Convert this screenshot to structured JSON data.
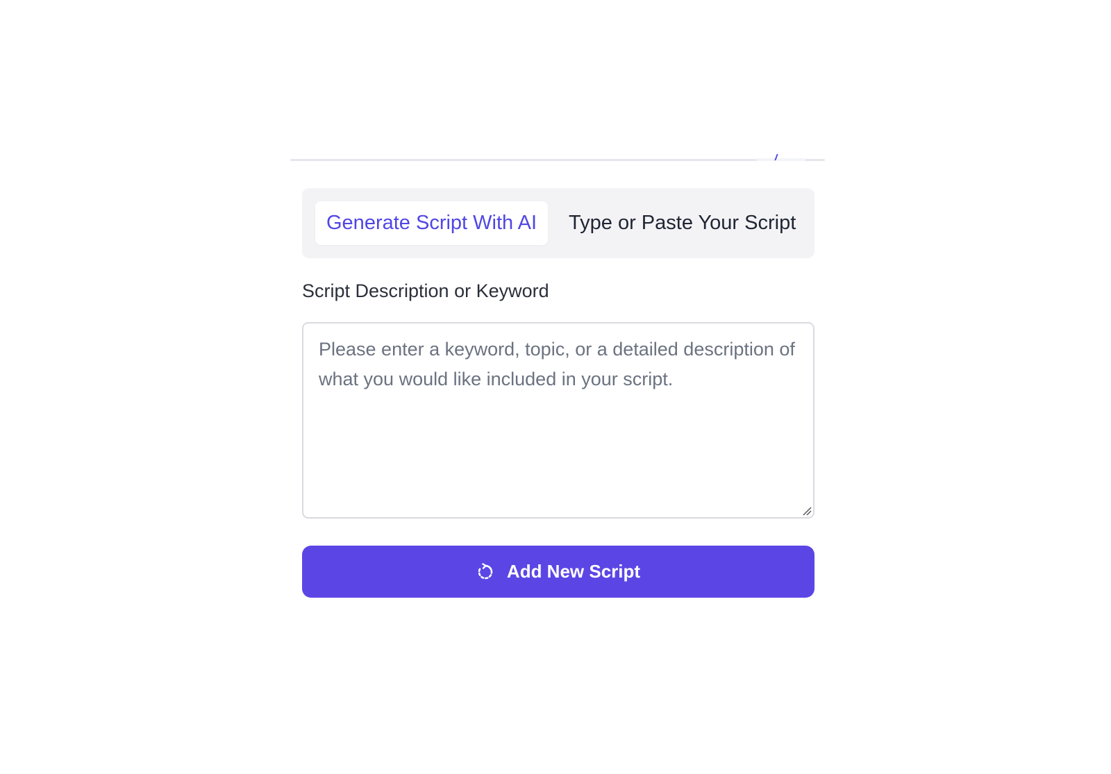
{
  "tabs": {
    "generate_ai": "Generate Script With AI",
    "type_paste": "Type or Paste Your Script",
    "active": "generate_ai"
  },
  "form": {
    "label": "Script Description or Keyword",
    "value": "",
    "placeholder": "Please enter a keyword, topic, or a detailed description of what you would like included in your script."
  },
  "action": {
    "add_label": "Add New Script",
    "icon": "refresh-icon"
  },
  "colors": {
    "accent": "#5b46e5",
    "tab_bar_bg": "#f3f3f6",
    "active_tab_text": "#5046e5"
  }
}
